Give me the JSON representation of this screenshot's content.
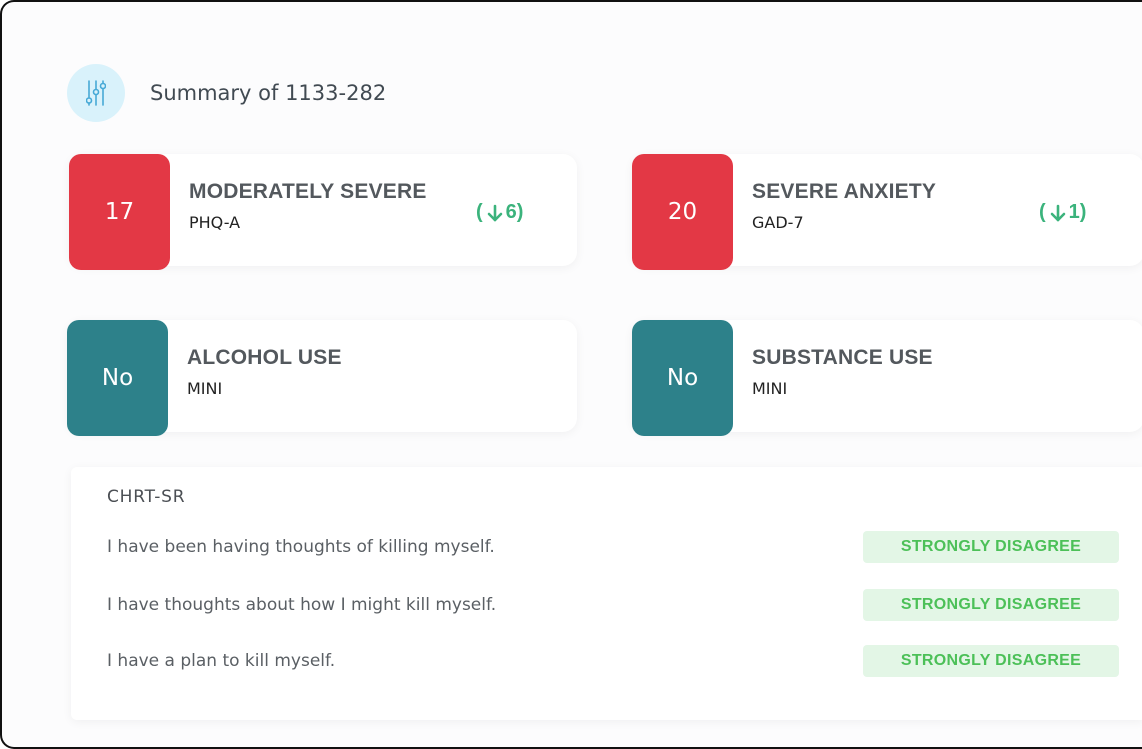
{
  "header": {
    "title": "Summary of 1133-282",
    "icon": "sliders-icon",
    "icon_bg": "#d9f2fb",
    "icon_color": "#46a9d6"
  },
  "cards": [
    {
      "score": "17",
      "title": "MODERATELY SEVERE",
      "subtitle": "PHQ-A",
      "change_value": "6",
      "change_icon": "arrow-down-icon",
      "tile_color": "#e33845"
    },
    {
      "score": "20",
      "title": "SEVERE ANXIETY",
      "subtitle": "GAD-7",
      "change_value": "1",
      "change_icon": "arrow-down-icon",
      "tile_color": "#e33845"
    },
    {
      "score": "No",
      "title": "ALCOHOL USE",
      "subtitle": "MINI",
      "tile_color": "#2d818a"
    },
    {
      "score": "No",
      "title": "SUBSTANCE USE",
      "subtitle": "MINI",
      "tile_color": "#2d818a"
    }
  ],
  "chrt": {
    "title": "CHRT-SR",
    "rows": [
      {
        "question": "I have been having thoughts of killing myself.",
        "answer": "STRONGLY DISAGREE"
      },
      {
        "question": "I have thoughts about how I might kill myself.",
        "answer": "STRONGLY DISAGREE"
      },
      {
        "question": "I have a plan to kill myself.",
        "answer": "STRONGLY DISAGREE"
      }
    ],
    "badge_bg": "#e3f6e6",
    "badge_color": "#4cc058"
  },
  "colors": {
    "change_green": "#3bb37c"
  }
}
